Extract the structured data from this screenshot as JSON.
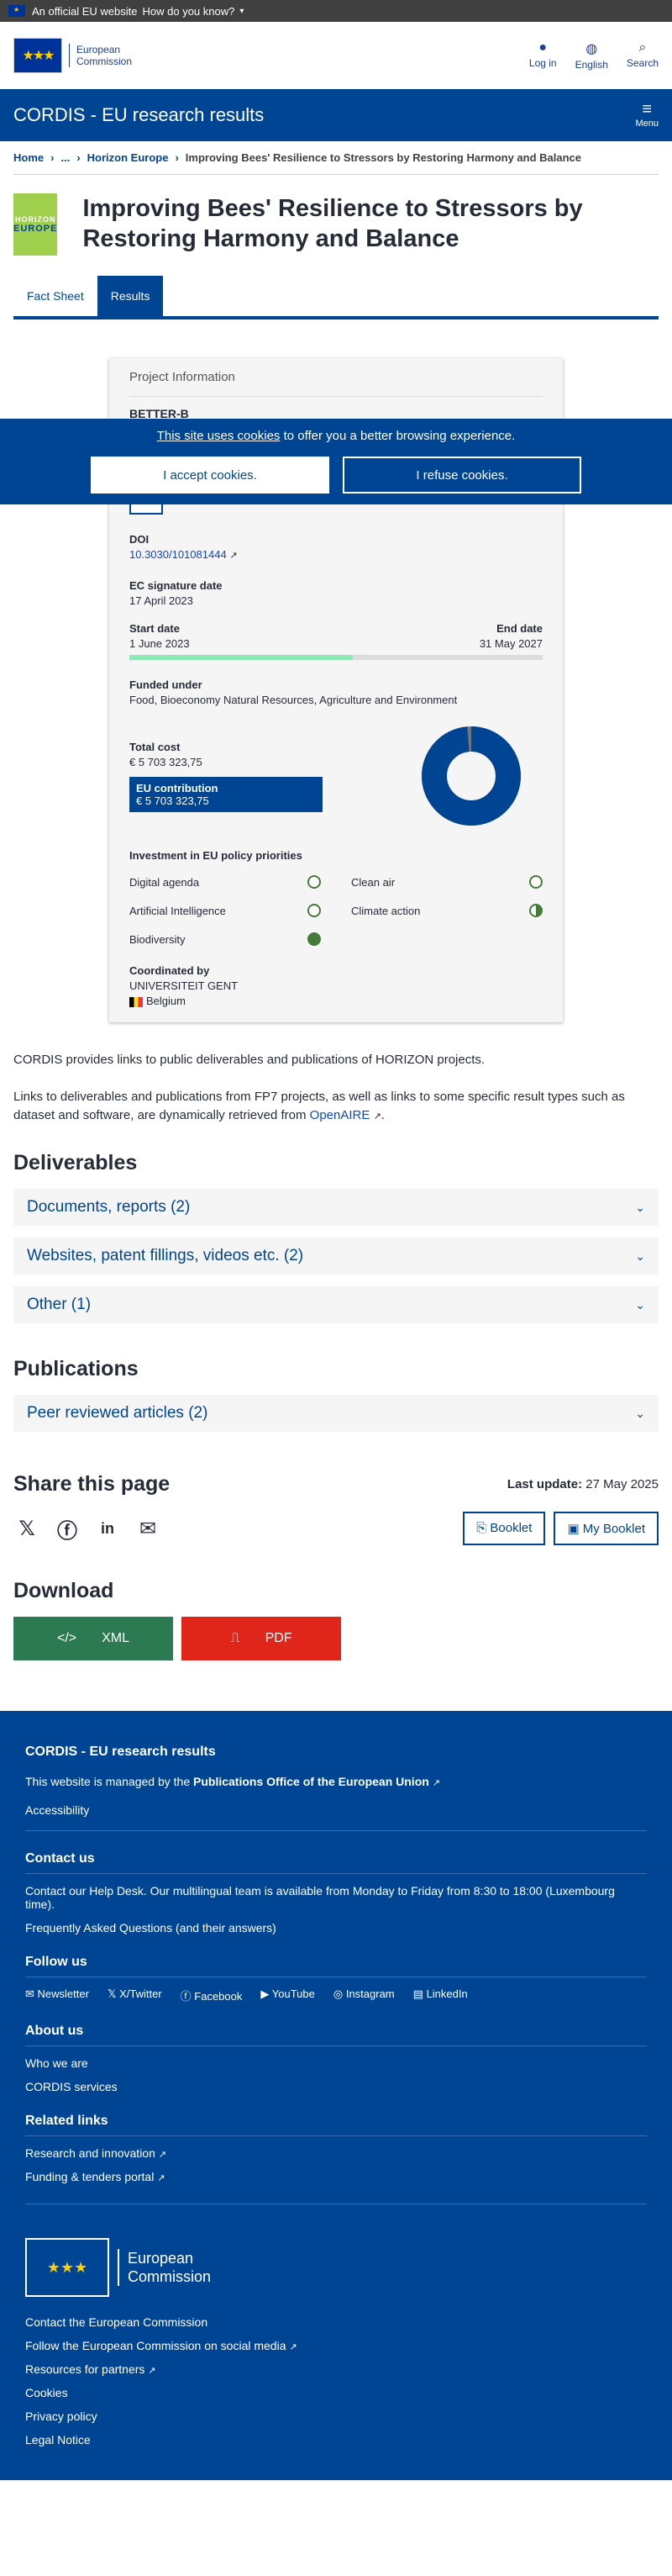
{
  "topbar": {
    "official": "An official EU website",
    "howknow": "How do you know?"
  },
  "header": {
    "logo": [
      "European",
      "Commission"
    ],
    "actions": [
      {
        "icon": "user-icon",
        "label": "Log in"
      },
      {
        "icon": "globe-icon",
        "label": "English"
      },
      {
        "icon": "search-icon",
        "label": "Search"
      }
    ]
  },
  "sitebar": {
    "name": "CORDIS - EU research results",
    "menu": "Menu"
  },
  "breadcrumb": {
    "home": "Home",
    "ellipsis": "...",
    "programme": "Horizon Europe",
    "current": "Improving Bees' Resilience to Stressors by Restoring Harmony and Balance"
  },
  "programme_logo": {
    "line1": "HORIZON",
    "line2": "EUROPE"
  },
  "page_title": "Improving Bees' Resilience to Stressors by Restoring Harmony and Balance",
  "tabs": [
    {
      "label": "Fact Sheet"
    },
    {
      "label": "Results"
    }
  ],
  "cookie": {
    "link": "This site uses cookies",
    "text": " to offer you a better browsing experience.",
    "accept": "I accept cookies.",
    "refuse": "I refuse cookies."
  },
  "project": {
    "panel_title": "Project Information",
    "acronym": "BETTER-B",
    "linkedin": "in",
    "doi_label": "DOI",
    "doi": "10.3030/101081444",
    "sig_label": "EC signature date",
    "sig_date": "17 April 2023",
    "start_label": "Start date",
    "start_date": "1 June 2023",
    "end_label": "End date",
    "end_date": "31 May 2027",
    "progress": 0.54,
    "funded_label": "Funded under",
    "funded": "Food, Bioeconomy Natural Resources, Agriculture and Environment",
    "total_label": "Total cost",
    "total": "€ 5 703 323,75",
    "eu_label": "EU contribution",
    "eu": "€ 5 703 323,75",
    "donut_share": 0.985,
    "prio_label": "Investment in EU policy priorities",
    "priorities": [
      {
        "label": "Digital agenda",
        "level": "empty"
      },
      {
        "label": "Clean air",
        "level": "empty"
      },
      {
        "label": "Artificial Intelligence",
        "level": "empty"
      },
      {
        "label": "Climate action",
        "level": "half"
      },
      {
        "label": "Biodiversity",
        "level": "full"
      }
    ],
    "coord_label": "Coordinated by",
    "coord": "UNIVERSITEIT GENT",
    "country": "Belgium"
  },
  "intro": {
    "p1": "CORDIS provides links to public deliverables and publications of HORIZON projects.",
    "p2": "Links to deliverables and publications from FP7 projects, as well as links to some specific result types such as dataset and software, are dynamically retrieved from ",
    "openaire": "OpenAIRE"
  },
  "deliverables": {
    "title": "Deliverables",
    "items": [
      "Documents, reports (2)",
      "Websites, patent fillings, videos etc. (2)",
      "Other (1)"
    ]
  },
  "publications": {
    "title": "Publications",
    "items": [
      "Peer reviewed articles (2)"
    ]
  },
  "share": {
    "title": "Share this page",
    "last_update_label": "Last update:",
    "last_update": "27 May 2025",
    "booklet": "Booklet",
    "my_booklet": "My Booklet"
  },
  "download": {
    "title": "Download",
    "xml": "XML",
    "pdf": "PDF"
  },
  "footer": {
    "title": "CORDIS - EU research results",
    "managed_pre": "This website is managed by the ",
    "managed_link": "Publications Office of the European Union",
    "accessibility": "Accessibility",
    "contact_title": "Contact us",
    "helpdesk": "Contact our Help Desk",
    "helpdesk_text": ". Our multilingual team is available from Monday to Friday from 8:30 to 18:00 (Luxembourg time).",
    "faq": "Frequently Asked Questions",
    "faq_text": " (and their answers)",
    "follow_title": "Follow us",
    "follow": [
      "Newsletter",
      "X/Twitter",
      "Facebook",
      "YouTube",
      "Instagram",
      "LinkedIn"
    ],
    "about_title": "About us",
    "who": "Who we are",
    "services": "CORDIS services",
    "related_title": "Related links",
    "research": "Research and innovation",
    "funding": "Funding & tenders portal",
    "ec_logo": [
      "European",
      "Commission"
    ],
    "bottom": [
      "Contact the European Commission",
      "Follow the European Commission on social media",
      "Resources for partners",
      "Cookies",
      "Privacy policy",
      "Legal Notice"
    ]
  }
}
